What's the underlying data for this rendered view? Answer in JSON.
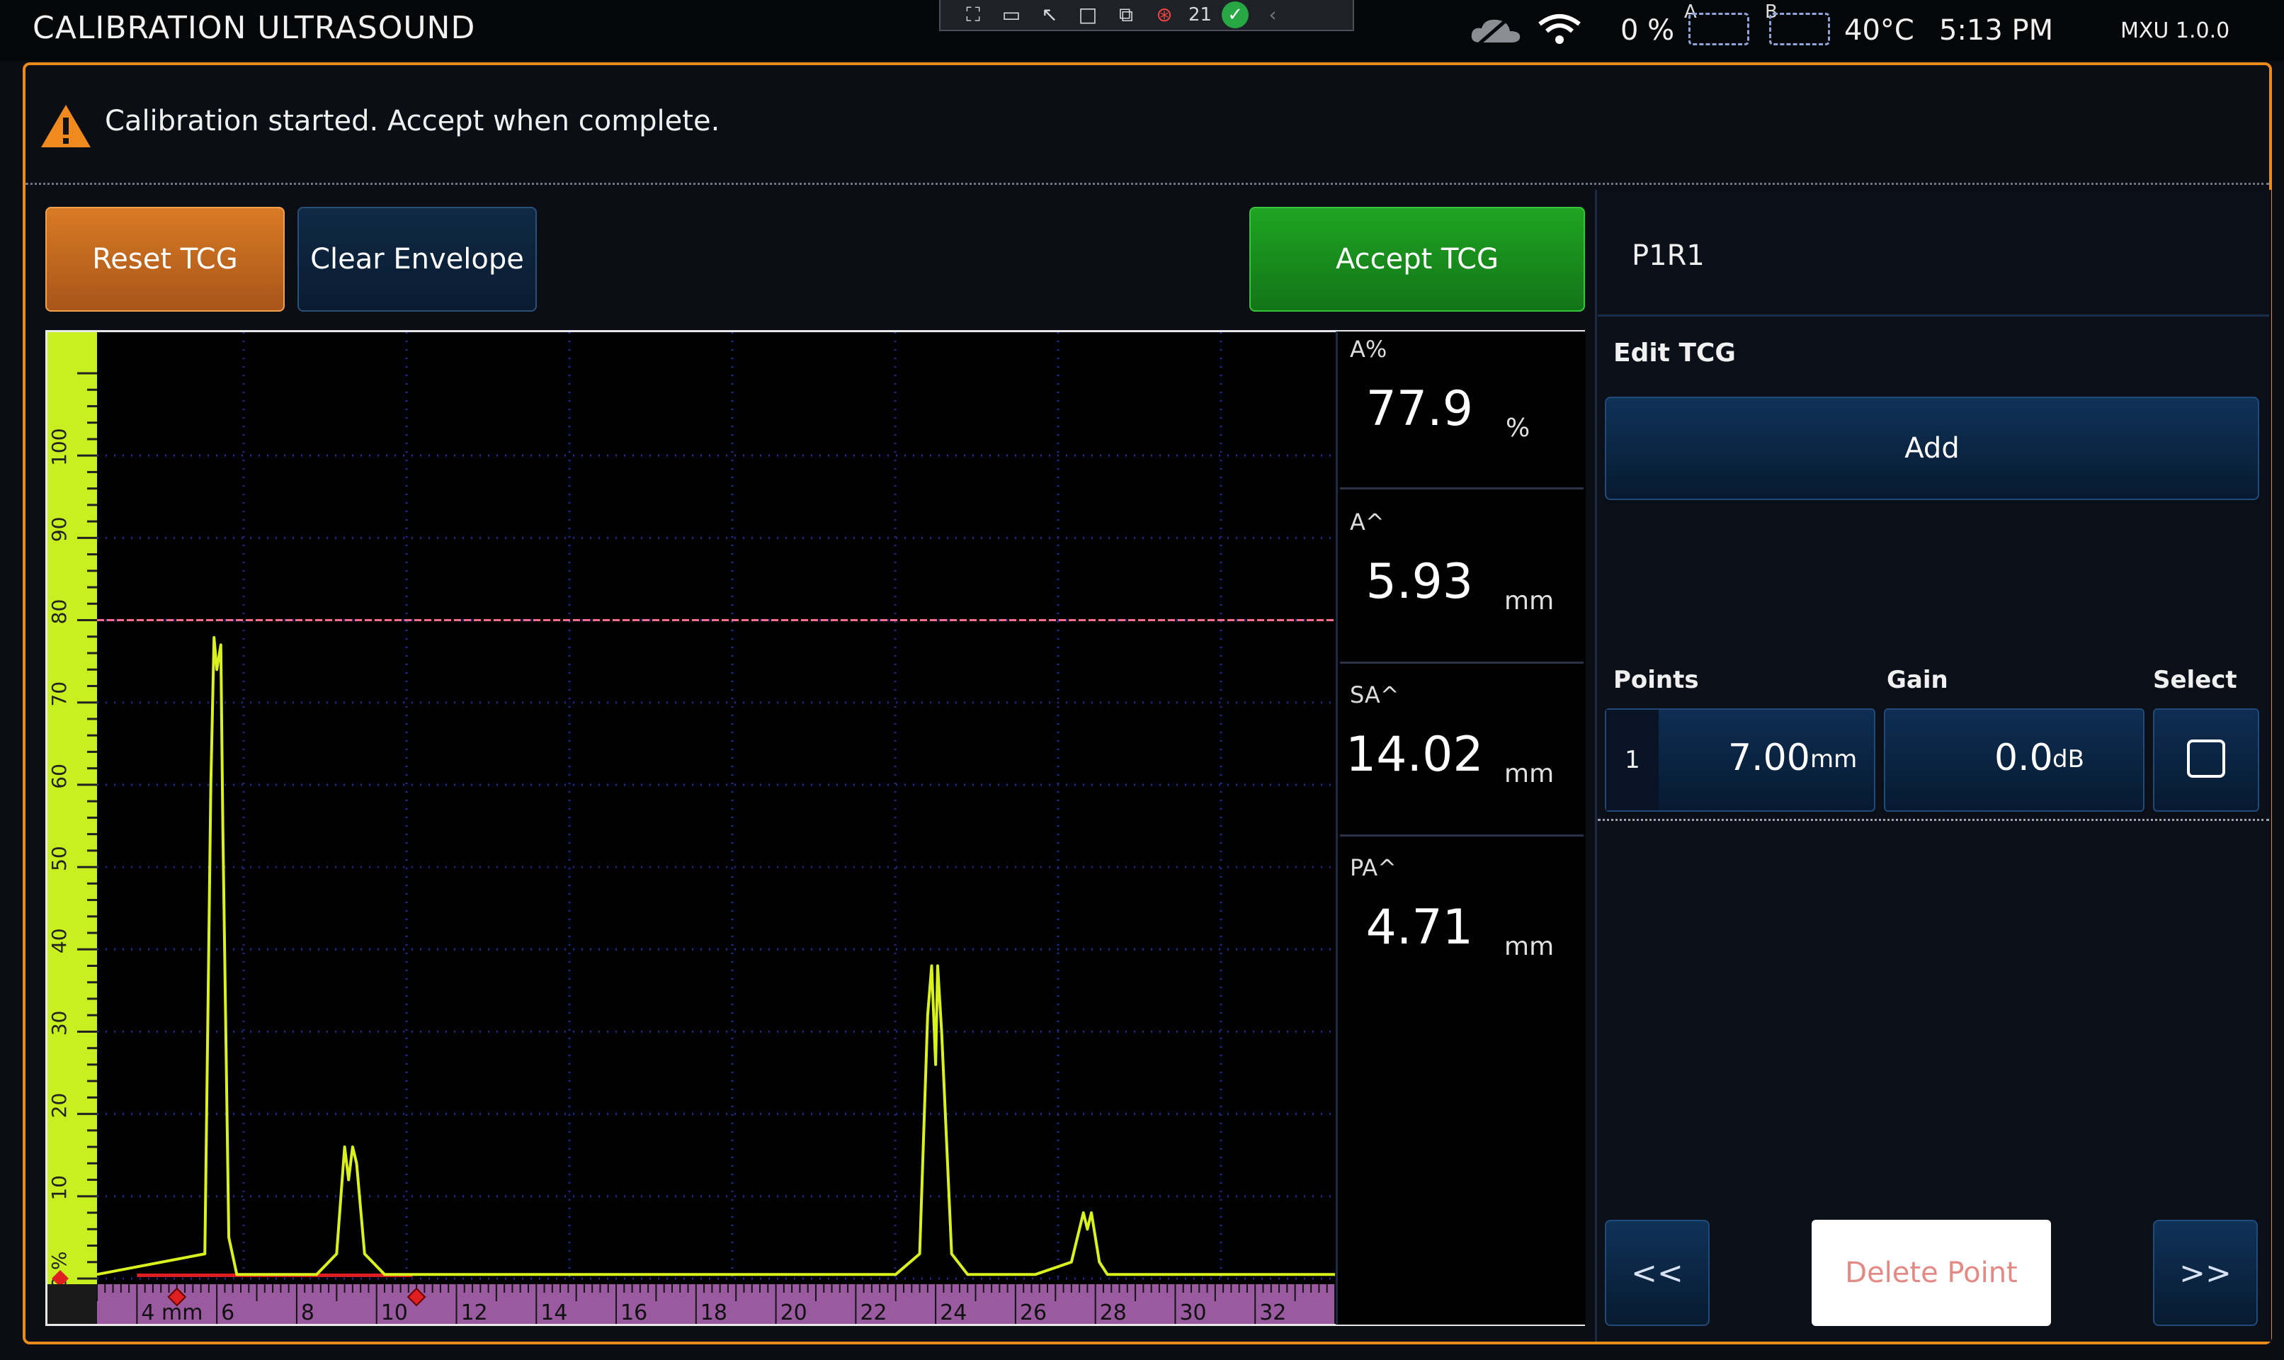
{
  "topbar": {
    "title": "CALIBRATION ULTRASOUND",
    "alarm_count": "21",
    "battery": "0 %",
    "drive_a": "A",
    "drive_b": "B",
    "temperature": "40°C",
    "time": "5:13 PM",
    "version": "MXU 1.0.0"
  },
  "notice": {
    "text": "Calibration started. Accept when complete."
  },
  "buttons": {
    "reset_tcg": "Reset TCG",
    "clear_envelope": "Clear Envelope",
    "accept_tcg": "Accept TCG"
  },
  "right_panel": {
    "channel": "P1R1",
    "edit_tcg": "Edit TCG",
    "add": "Add",
    "points_header": "Points",
    "gain_header": "Gain",
    "select_header": "Select",
    "point_index": "1",
    "point_value": "7.00",
    "point_unit": "mm",
    "gain_value": "0.0",
    "gain_unit": "dB",
    "prev": "<<",
    "next": ">>",
    "delete_point": "Delete Point"
  },
  "readings": [
    {
      "label": "A%",
      "value": "77.9",
      "unit": "%"
    },
    {
      "label": "A^",
      "value": "5.93",
      "unit": "mm"
    },
    {
      "label": "SA^",
      "value": "14.02",
      "unit": "mm"
    },
    {
      "label": "PA^",
      "value": "4.71",
      "unit": "mm"
    }
  ],
  "colors": {
    "trace": "#d9f21e",
    "reference_line": "#ff6b8a",
    "amplitude_ruler": "#c8f020",
    "depth_ruler": "#9a5aa0",
    "frame": "#e88a1c",
    "accept": "#1fa423"
  },
  "chart_data": {
    "type": "line",
    "title": "",
    "xlabel": "mm",
    "ylabel": "%",
    "xlim": [
      3.0,
      34.0
    ],
    "ylim": [
      0,
      110
    ],
    "y_ticks": [
      "0 %",
      "10",
      "20",
      "30",
      "40",
      "50",
      "60",
      "70",
      "80",
      "90",
      "100"
    ],
    "x_ticks": [
      "4 mm",
      "6",
      "8",
      "10",
      "12",
      "14",
      "16",
      "18",
      "20",
      "22",
      "24",
      "26",
      "28",
      "30",
      "32"
    ],
    "reference_level": 80,
    "grid": true,
    "series": [
      {
        "x": [
          3.0,
          5.7,
          5.85,
          5.93,
          6.0,
          6.1,
          6.15,
          6.3,
          6.5,
          8.5,
          9.0,
          9.2,
          9.3,
          9.4,
          9.5,
          9.7,
          10.2,
          23.0,
          23.6,
          23.8,
          23.9,
          24.0,
          24.05,
          24.15,
          24.4,
          24.8,
          26.5,
          27.4,
          27.7,
          27.8,
          27.9,
          28.1,
          28.3,
          34.0
        ],
        "y": [
          0.5,
          3,
          60,
          77.9,
          74,
          77,
          55,
          5,
          0.5,
          0.5,
          3,
          16,
          12,
          16,
          14,
          3,
          0.5,
          0.5,
          3,
          32,
          38,
          26,
          38,
          30,
          3,
          0.5,
          0.5,
          2,
          8,
          6,
          8,
          2,
          0.5,
          0.5
        ]
      }
    ]
  }
}
